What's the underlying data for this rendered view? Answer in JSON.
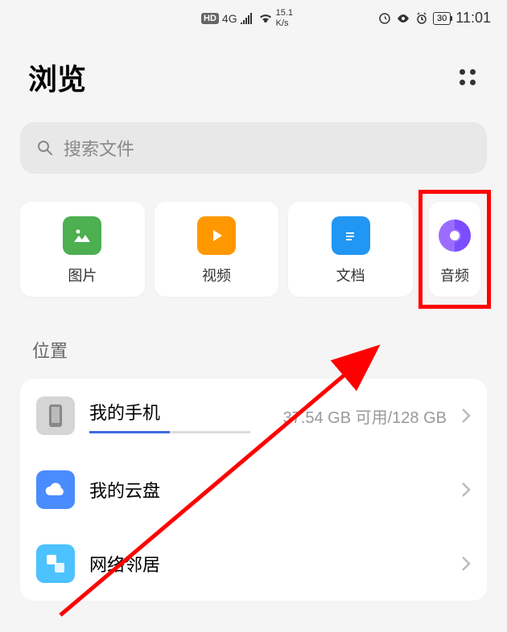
{
  "status_bar": {
    "hd": "HD",
    "network_type": "4G",
    "speed": "15.1",
    "speed_unit": "K/s",
    "battery": "30",
    "time": "11:01"
  },
  "header": {
    "title": "浏览"
  },
  "search": {
    "placeholder": "搜索文件"
  },
  "categories": [
    {
      "label": "图片",
      "color": "#4CAF50"
    },
    {
      "label": "视频",
      "color": "#FF9800"
    },
    {
      "label": "文档",
      "color": "#2196F3"
    },
    {
      "label": "音频",
      "color": "#9C27B0",
      "highlighted": true
    }
  ],
  "section": {
    "title": "位置"
  },
  "locations": [
    {
      "name": "我的手机",
      "info": "37.54 GB 可用/128 GB",
      "icon_color": "#999",
      "has_progress": true
    },
    {
      "name": "我的云盘",
      "info": "",
      "icon_color": "#4a8cff"
    },
    {
      "name": "网络邻居",
      "info": "",
      "icon_color": "#4cc2ff"
    }
  ]
}
